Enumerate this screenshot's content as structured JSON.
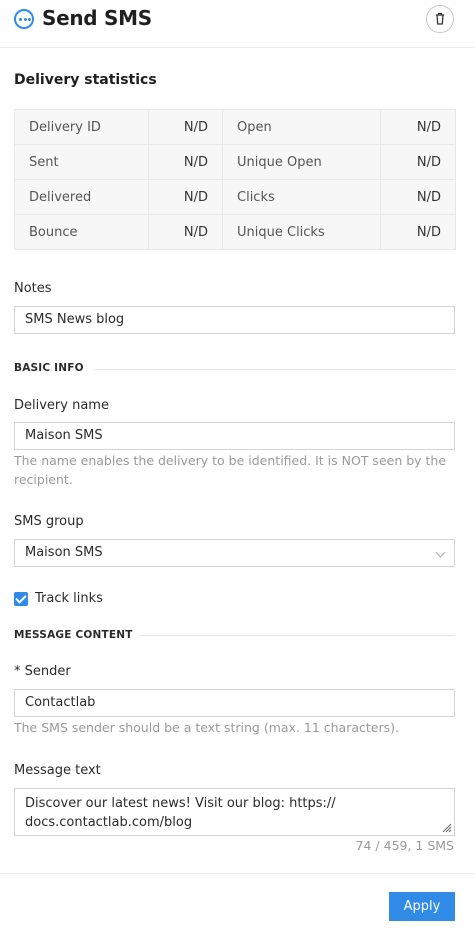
{
  "header": {
    "title": "Send SMS",
    "icon": "message-icon",
    "delete_icon": "trash-icon",
    "accent_color": "#2f8be6"
  },
  "stats": {
    "title": "Delivery statistics",
    "rows": [
      {
        "left_label": "Delivery ID",
        "left_value": "N/D",
        "right_label": "Open",
        "right_value": "N/D"
      },
      {
        "left_label": "Sent",
        "left_value": "N/D",
        "right_label": "Unique Open",
        "right_value": "N/D"
      },
      {
        "left_label": "Delivered",
        "left_value": "N/D",
        "right_label": "Clicks",
        "right_value": "N/D"
      },
      {
        "left_label": "Bounce",
        "left_value": "N/D",
        "right_label": "Unique Clicks",
        "right_value": "N/D"
      }
    ]
  },
  "notes": {
    "label": "Notes",
    "value": "SMS News blog"
  },
  "basic_info": {
    "title": "BASIC INFO",
    "delivery_name": {
      "label": "Delivery name",
      "value": "Maison SMS",
      "help": "The name enables the delivery to be identified. It is NOT seen by the recipient."
    },
    "sms_group": {
      "label": "SMS group",
      "value": "Maison SMS"
    },
    "track_links": {
      "label": "Track links",
      "checked": true
    }
  },
  "message_content": {
    "title": "MESSAGE CONTENT",
    "sender": {
      "required_mark": "*",
      "label": "Sender",
      "value": "Contactlab",
      "help": "The SMS sender should be a text string (max. 11 characters)."
    },
    "message_text": {
      "label": "Message text",
      "value": "Discover our latest news! Visit our blog: https:// docs.contactlab.com/blog",
      "counter": "74 / 459, 1 SMS"
    }
  },
  "footer": {
    "apply_label": "Apply"
  }
}
